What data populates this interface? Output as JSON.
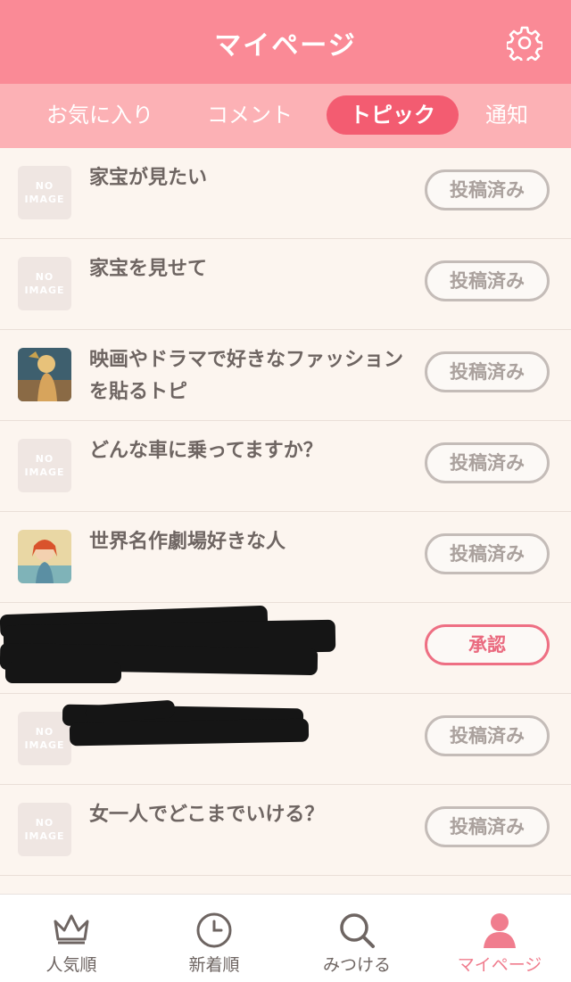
{
  "header": {
    "title": "マイページ",
    "settings_icon": "gear-icon"
  },
  "tabs": [
    {
      "label": "お気に入り",
      "active": false
    },
    {
      "label": "コメント",
      "active": false
    },
    {
      "label": "トピック",
      "active": true
    },
    {
      "label": "通知",
      "active": false
    }
  ],
  "no_image": {
    "line1": "NO",
    "line2": "IMAGE"
  },
  "topics": [
    {
      "title": "家宝が見たい",
      "status": "投稿済み",
      "thumbnail": "no-image"
    },
    {
      "title": "家宝を見せて",
      "status": "投稿済み",
      "thumbnail": "no-image"
    },
    {
      "title": "映画やドラマで好きなファッションを貼るトピ",
      "status": "投稿済み",
      "thumbnail": "photo"
    },
    {
      "title": "どんな車に乗ってますか？",
      "status": "投稿済み",
      "thumbnail": "no-image"
    },
    {
      "title": "世界名作劇場好きな人",
      "status": "投稿済み",
      "thumbnail": "photo"
    },
    {
      "title": "",
      "status": "承認",
      "thumbnail": "redacted"
    },
    {
      "title": "",
      "status": "投稿済み",
      "thumbnail": "no-image"
    },
    {
      "title": "女一人でどこまでいける？",
      "status": "投稿済み",
      "thumbnail": "no-image"
    }
  ],
  "bottom_nav": [
    {
      "label": "人気順",
      "icon": "crown-icon",
      "active": false
    },
    {
      "label": "新着順",
      "icon": "clock-icon",
      "active": false
    },
    {
      "label": "みつける",
      "icon": "search-icon",
      "active": false
    },
    {
      "label": "マイページ",
      "icon": "user-icon",
      "active": true
    }
  ],
  "colors": {
    "header": "#fa8a96",
    "tabbar": "#fcb1b5",
    "active_tab": "#f35c71",
    "accent": "#f07d8e",
    "background": "#fcf5ef"
  }
}
